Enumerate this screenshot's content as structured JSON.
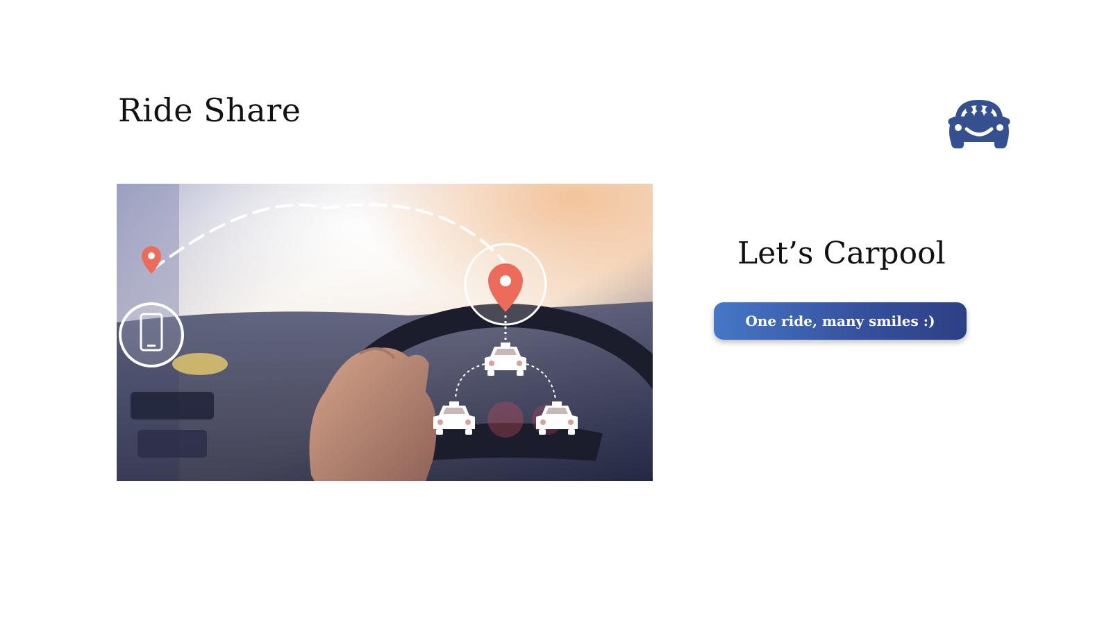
{
  "slide": {
    "title": "Ride Share",
    "headline": "Let’s Carpool",
    "cta_label": "One ride, many smiles :)"
  },
  "icons": {
    "logo": "carpool-car-smile-icon",
    "pin": "location-pin-icon",
    "phone": "smartphone-icon",
    "taxi": "taxi-icon"
  },
  "colors": {
    "logo": "#34508f",
    "button_start": "#4577c6",
    "button_end": "#2e3f85",
    "pin": "#ec6b5a"
  }
}
